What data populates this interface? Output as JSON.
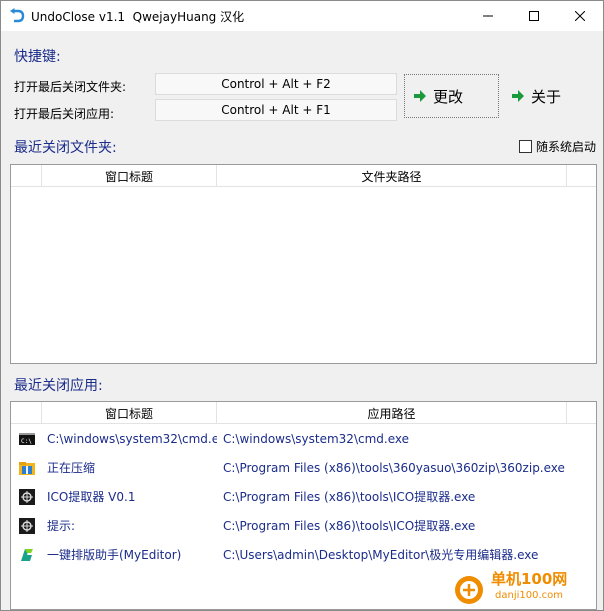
{
  "window": {
    "title": "UndoClose v1.1  QwejayHuang 汉化"
  },
  "hotkeys": {
    "section_title": "快捷键:",
    "folder_label": "打开最后关闭文件夹:",
    "folder_value": "Control + Alt + F2",
    "app_label": "打开最后关闭应用:",
    "app_value": "Control + Alt + F1",
    "change_button": "更改",
    "about_button": "关于"
  },
  "folders": {
    "section_title": "最近关闭文件夹:",
    "autostart_label": "随系统启动",
    "autostart_checked": false,
    "columns": [
      "窗口标题",
      "文件夹路径"
    ],
    "rows": []
  },
  "apps": {
    "section_title": "最近关闭应用:",
    "columns": [
      "窗口标题",
      "应用路径"
    ],
    "rows": [
      {
        "icon": "cmd-icon",
        "title": "C:\\windows\\system32\\cmd.e",
        "path": "C:\\windows\\system32\\cmd.exe"
      },
      {
        "icon": "archive-folder-icon",
        "title": "正在压缩",
        "path": "C:\\Program Files (x86)\\tools\\360yasuo\\360zip\\360zip.exe"
      },
      {
        "icon": "ico-extractor-icon",
        "title": "ICO提取器 V0.1",
        "path": "C:\\Program Files (x86)\\tools\\ICO提取器.exe"
      },
      {
        "icon": "ico-extractor-icon",
        "title": "提示:",
        "path": "C:\\Program Files (x86)\\tools\\ICO提取器.exe"
      },
      {
        "icon": "myeditor-icon",
        "title": "一键排版助手(MyEditor)",
        "path": "C:\\Users\\admin\\Desktop\\MyEditor\\极光专用编辑器.exe"
      }
    ]
  },
  "watermark": {
    "site_name": "单机100网",
    "site_url": "danji100.com"
  },
  "colors": {
    "accent_text": "#1b2c8a",
    "arrow_green": "#1a9a3a",
    "watermark_orange": "#f08c00"
  }
}
